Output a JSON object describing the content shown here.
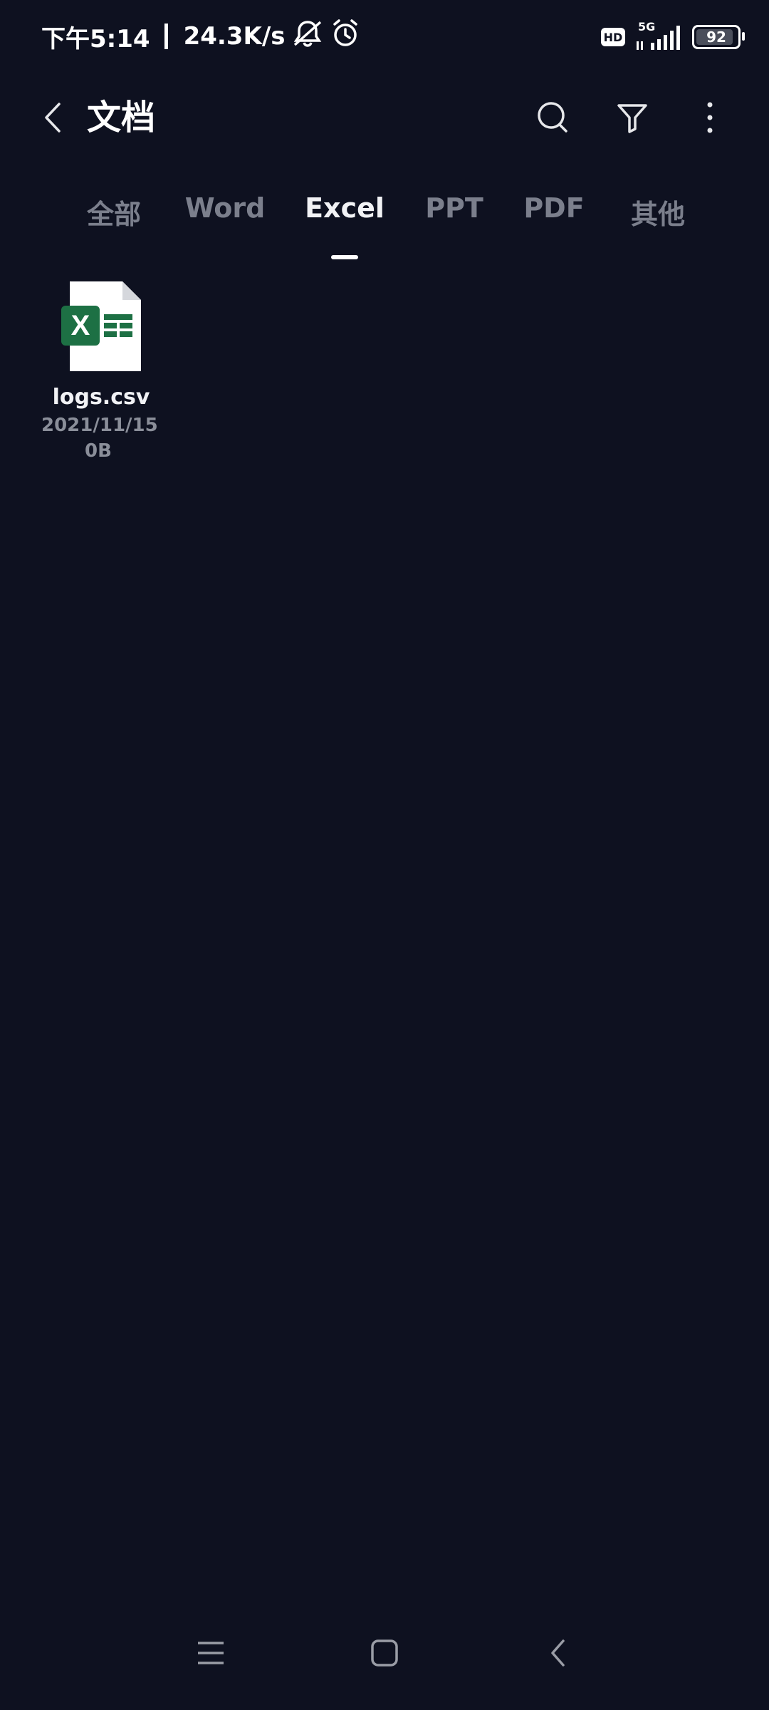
{
  "status_bar": {
    "time": "下午5:14",
    "net_speed": "24.3K/s",
    "hd_badge": "HD",
    "network_type": "5G",
    "battery_level": "92",
    "battery_fraction": 0.92
  },
  "header": {
    "title": "文档"
  },
  "tabs": [
    {
      "label": "全部"
    },
    {
      "label": "Word"
    },
    {
      "label": "Excel",
      "active": true
    },
    {
      "label": "PPT"
    },
    {
      "label": "PDF"
    },
    {
      "label": "其他"
    }
  ],
  "files": [
    {
      "name": "logs.csv",
      "date": "2021/11/15",
      "size": "0B",
      "icon": "excel-file-icon"
    }
  ],
  "colors": {
    "background": "#0e1120",
    "excel_green": "#1d7044",
    "tab_inactive": "#7b7f8c",
    "tab_active": "#f1f2f5"
  }
}
